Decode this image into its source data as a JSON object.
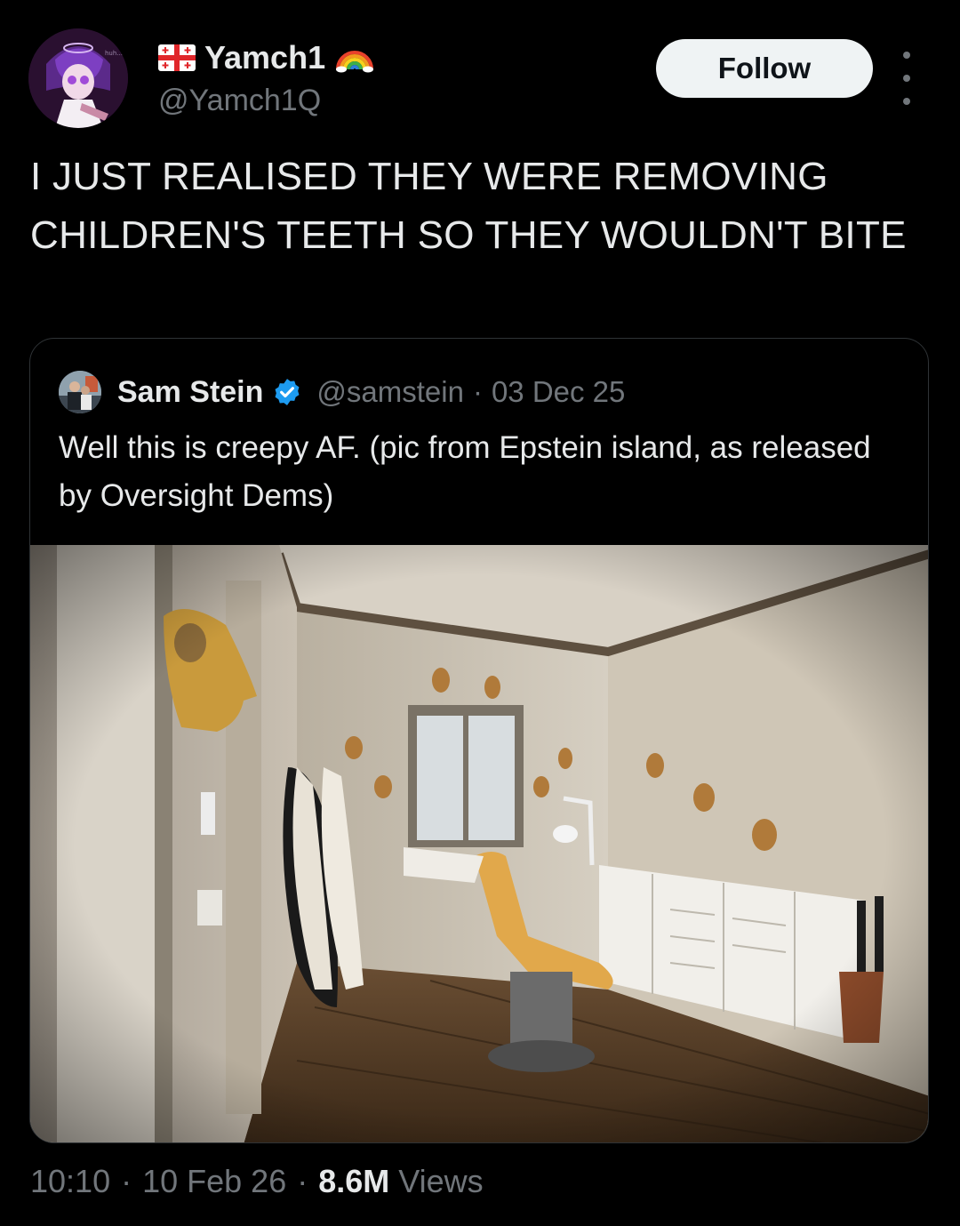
{
  "post": {
    "author_name": "Yamch1",
    "author_handle": "@Yamch1Q",
    "avatar_caption": "huh...",
    "follow_label": "Follow",
    "text": "I JUST REALISED THEY WERE REMOVING CHILDREN'S TEETH SO THEY WOULDN'T BITE",
    "time": "10:10",
    "date": "10 Feb 26",
    "views_count": "8.6M",
    "views_label": "Views"
  },
  "quote": {
    "author_name": "Sam Stein",
    "author_handle": "@samstein",
    "date": "03 Dec 25",
    "text": "Well this is creepy AF. (pic from Epstein island, as released by Oversight Dems)",
    "verified": true
  },
  "icons": {
    "flag": "georgia-flag-icon",
    "rainbow": "rainbow-icon",
    "verified": "verified-badge-icon",
    "more": "more-options-icon"
  },
  "colors": {
    "background": "#000000",
    "text_primary": "#e7e9ea",
    "text_secondary": "#71767b",
    "follow_bg": "#eff3f4",
    "border": "#2f3336",
    "verified_blue": "#1d9bf0"
  }
}
